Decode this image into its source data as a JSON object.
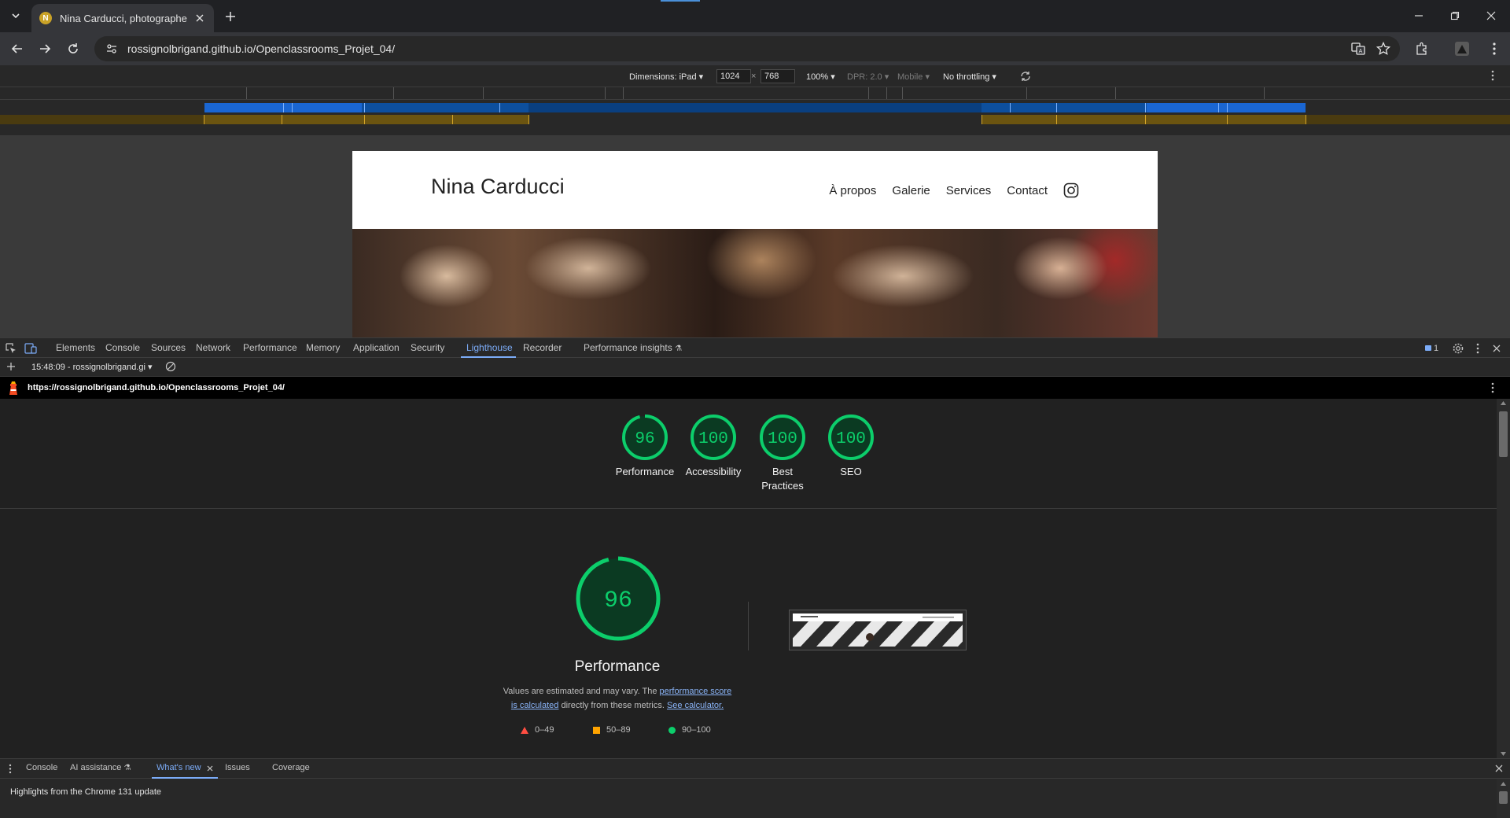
{
  "browser": {
    "tab_title": "Nina Carducci, photographe",
    "favicon_letter": "N",
    "url": "rossignolbrigand.github.io/Openclassrooms_Projet_04/"
  },
  "device_toolbar": {
    "dimensions_label": "Dimensions: iPad",
    "width": "1024",
    "times": "×",
    "height": "768",
    "zoom": "100%",
    "dpr": "DPR: 2.0",
    "mode": "Mobile",
    "throttling": "No throttling"
  },
  "site": {
    "logo": "Nina Carducci",
    "nav": [
      "À propos",
      "Galerie",
      "Services",
      "Contact"
    ]
  },
  "devtools": {
    "tabs": [
      "Elements",
      "Console",
      "Sources",
      "Network",
      "Performance",
      "Memory",
      "Application",
      "Security",
      "Lighthouse",
      "Recorder",
      "Performance insights"
    ],
    "active_tab": "Lighthouse",
    "issues_count": "1",
    "report_selector": "15:48:09 - rossignolbrigand.gi",
    "report_url": "https://rossignolbrigand.github.io/Openclassrooms_Projet_04/"
  },
  "lighthouse": {
    "scores": [
      {
        "value": 96,
        "label": "Performance"
      },
      {
        "value": 100,
        "label": "Accessibility"
      },
      {
        "value": 100,
        "label": "Best Practices"
      },
      {
        "value": 100,
        "label": "SEO"
      }
    ],
    "main_score": 96,
    "main_title": "Performance",
    "desc_pre": "Values are estimated and may vary. The ",
    "desc_link1": "performance score is calculated",
    "desc_mid": " directly from these metrics. ",
    "desc_link2": "See calculator.",
    "legend": [
      {
        "range": "0–49",
        "color": "#ff4e42"
      },
      {
        "range": "50–89",
        "color": "#ffa400"
      },
      {
        "range": "90–100",
        "color": "#0cce6b"
      }
    ],
    "good_color": "#0cce6b",
    "good_bg": "#0b3a22"
  },
  "drawer": {
    "tabs": [
      "Console",
      "AI assistance",
      "What's new",
      "Issues",
      "Coverage"
    ],
    "active_tab": "What's new",
    "content": "Highlights from the Chrome 131 update"
  }
}
